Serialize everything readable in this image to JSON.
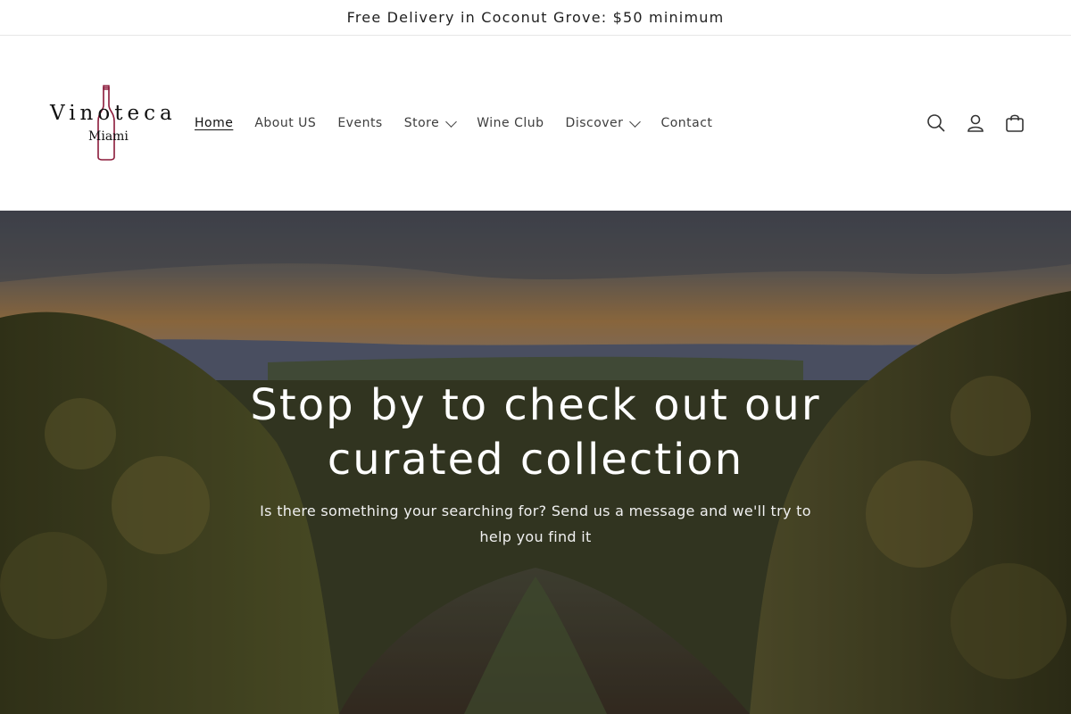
{
  "announcement": {
    "text": "Free Delivery in Coconut Grove: $50 minimum"
  },
  "logo": {
    "main": "Vinoteca",
    "sub": "Miami"
  },
  "nav": {
    "items": [
      {
        "label": "Home",
        "active": true,
        "dropdown": false
      },
      {
        "label": "About US",
        "active": false,
        "dropdown": false
      },
      {
        "label": "Events",
        "active": false,
        "dropdown": false
      },
      {
        "label": "Store",
        "active": false,
        "dropdown": true
      },
      {
        "label": "Wine Club",
        "active": false,
        "dropdown": false
      },
      {
        "label": "Discover",
        "active": false,
        "dropdown": true
      },
      {
        "label": "Contact",
        "active": false,
        "dropdown": false
      }
    ]
  },
  "header_icons": [
    "search-icon",
    "account-icon",
    "cart-icon"
  ],
  "hero": {
    "title": "Stop by to check out our curated collection",
    "subtitle": "Is there something your searching for? Send us a message and we'll try to help you find it"
  },
  "colors": {
    "bottle": "#8b1a3a",
    "text": "#1f1f1f"
  }
}
